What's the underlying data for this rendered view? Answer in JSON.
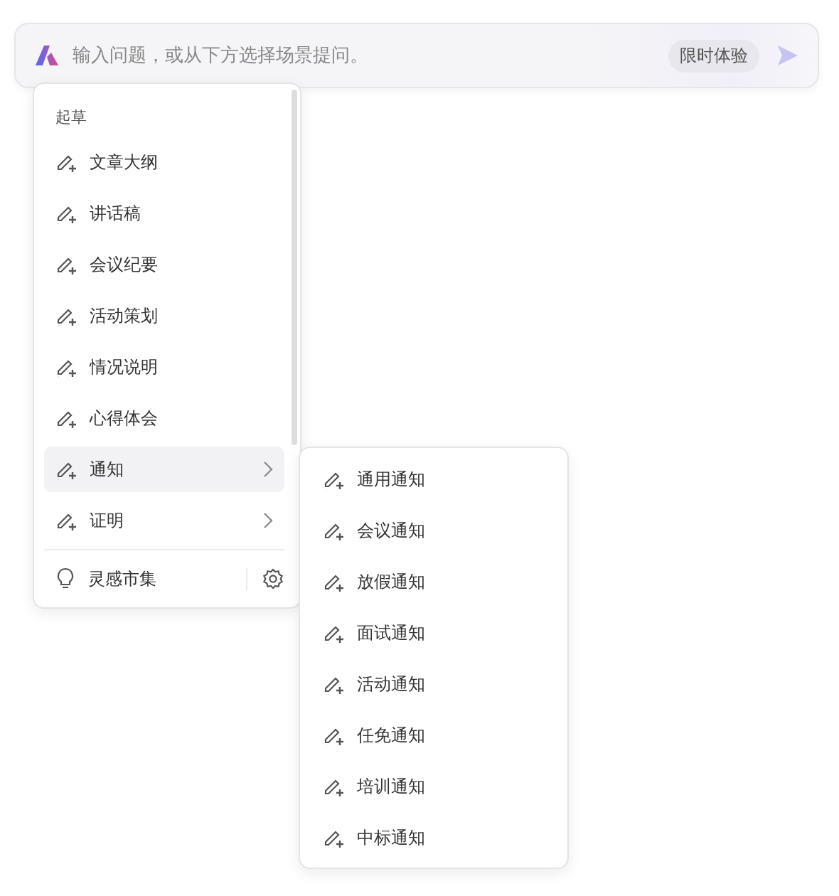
{
  "search": {
    "placeholder": "输入问题，或从下方选择场景提问。",
    "badge": "限时体验"
  },
  "menu": {
    "section_title": "起草",
    "items": [
      {
        "label": "文章大纲",
        "kind": "action",
        "selected": false
      },
      {
        "label": "讲话稿",
        "kind": "action",
        "selected": false
      },
      {
        "label": "会议纪要",
        "kind": "action",
        "selected": false
      },
      {
        "label": "活动策划",
        "kind": "action",
        "selected": false
      },
      {
        "label": "情况说明",
        "kind": "action",
        "selected": false
      },
      {
        "label": "心得体会",
        "kind": "action",
        "selected": false
      },
      {
        "label": "通知",
        "kind": "submenu",
        "selected": true
      },
      {
        "label": "证明",
        "kind": "submenu",
        "selected": false
      }
    ],
    "footer": {
      "label": "灵感市集"
    }
  },
  "submenu": {
    "items": [
      {
        "label": "通用通知"
      },
      {
        "label": "会议通知"
      },
      {
        "label": "放假通知"
      },
      {
        "label": "面试通知"
      },
      {
        "label": "活动通知"
      },
      {
        "label": "任免通知"
      },
      {
        "label": "培训通知"
      },
      {
        "label": "中标通知"
      }
    ]
  }
}
